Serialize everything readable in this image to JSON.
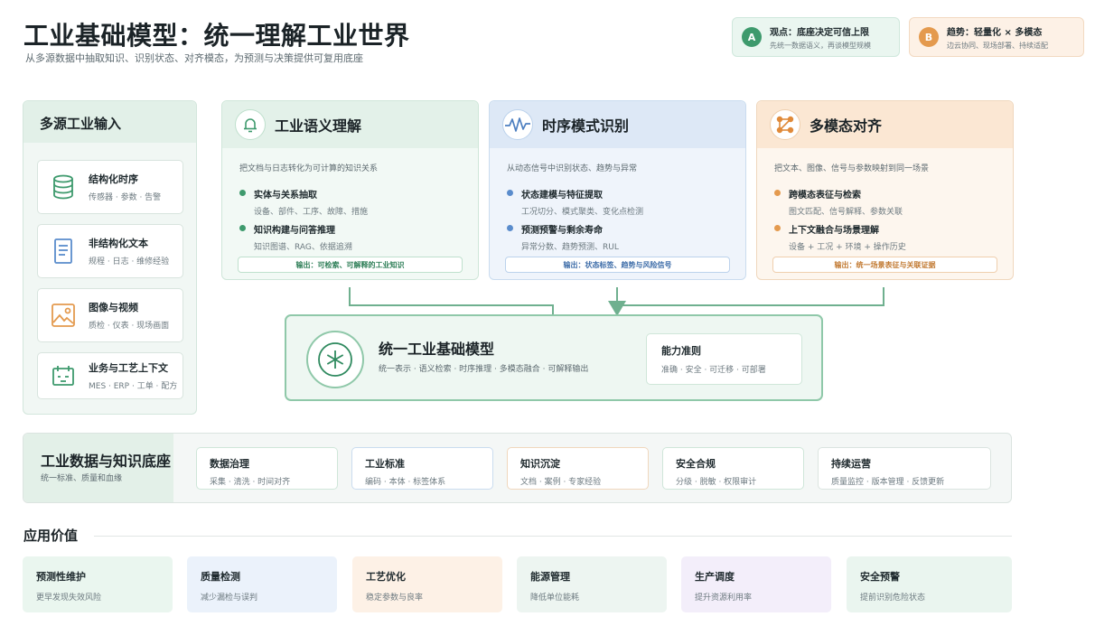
{
  "header": {
    "title": "工业基础模型：统一理解工业世界",
    "subtitle": "从多源数据中抽取知识、识别状态、对齐模态，为预测与决策提供可复用底座"
  },
  "chips": [
    {
      "badge": "A",
      "title": "观点：底座决定可信上限",
      "sub": "先统一数据语义，再谈模型规模"
    },
    {
      "badge": "B",
      "title": "趋势：轻量化 × 多模态",
      "sub": "边云协同、现场部署、持续适配"
    }
  ],
  "inputs": {
    "title": "多源工业输入",
    "items": [
      {
        "icon": "database-icon",
        "title": "结构化时序",
        "sub": "传感器 · 参数 · 告警"
      },
      {
        "icon": "document-icon",
        "title": "非结构化文本",
        "sub": "规程 · 日志 · 维修经验"
      },
      {
        "icon": "image-icon",
        "title": "图像与视频",
        "sub": "质检 · 仪表 · 现场画面"
      },
      {
        "icon": "calendar-icon",
        "title": "业务与工艺上下文",
        "sub": "MES · ERP · 工单 · 配方"
      }
    ]
  },
  "capabilities": [
    {
      "icon": "bell-icon",
      "title": "工业语义理解",
      "desc": "把文档与日志转化为可计算的知识关系",
      "items": [
        {
          "title": "实体与关系抽取",
          "sub": "设备、部件、工序、故障、措施"
        },
        {
          "title": "知识构建与问答推理",
          "sub": "知识图谱、RAG、依据追溯"
        }
      ],
      "output": "输出：可检索、可解释的工业知识"
    },
    {
      "icon": "waveform-icon",
      "title": "时序模式识别",
      "desc": "从动态信号中识别状态、趋势与异常",
      "items": [
        {
          "title": "状态建模与特征提取",
          "sub": "工况切分、模式聚类、变化点检测"
        },
        {
          "title": "预测预警与剩余寿命",
          "sub": "异常分数、趋势预测、RUL"
        }
      ],
      "output": "输出：状态标签、趋势与风险信号"
    },
    {
      "icon": "network-icon",
      "title": "多模态对齐",
      "desc": "把文本、图像、信号与参数映射到同一场景",
      "items": [
        {
          "title": "跨模态表征与检索",
          "sub": "图文匹配、信号解释、参数关联"
        },
        {
          "title": "上下文融合与场景理解",
          "sub": "设备 + 工况 + 环境 + 操作历史"
        }
      ],
      "output": "输出：统一场景表征与关联证据"
    }
  ],
  "core": {
    "title": "统一工业基础模型",
    "sub": "统一表示 · 语义检索 · 时序推理 · 多模态融合 · 可解释输出",
    "card_title": "能力准则",
    "card_sub": "准确 · 安全 · 可迁移 · 可部署"
  },
  "foundation": {
    "title": "工业数据与知识底座",
    "sub": "统一标准、质量和血缘",
    "items": [
      {
        "title": "数据治理",
        "sub": "采集 · 清洗 · 时间对齐"
      },
      {
        "title": "工业标准",
        "sub": "编码 · 本体 · 标签体系"
      },
      {
        "title": "知识沉淀",
        "sub": "文档 · 案例 · 专家经验"
      },
      {
        "title": "安全合规",
        "sub": "分级 · 脱敏 · 权限审计"
      },
      {
        "title": "持续运营",
        "sub": "质量监控 · 版本管理 · 反馈更新"
      }
    ]
  },
  "applications": {
    "title": "应用价值",
    "items": [
      {
        "title": "预测性维护",
        "sub": "更早发现失效风险",
        "color": "#eaf6ef"
      },
      {
        "title": "质量检测",
        "sub": "减少漏检与误判",
        "color": "#ebf2fb"
      },
      {
        "title": "工艺优化",
        "sub": "稳定参数与良率",
        "color": "#fdf1e6"
      },
      {
        "title": "能源管理",
        "sub": "降低单位能耗",
        "color": "#edf5f1"
      },
      {
        "title": "生产调度",
        "sub": "提升资源利用率",
        "color": "#f3eefa"
      },
      {
        "title": "安全预警",
        "sub": "提前识别危险状态",
        "color": "#eaf5ef"
      }
    ]
  },
  "colors": {
    "green": "#3e9a6d",
    "blue": "#5a8ccc",
    "orange": "#e49a4e",
    "connector": "#6fb08f"
  }
}
